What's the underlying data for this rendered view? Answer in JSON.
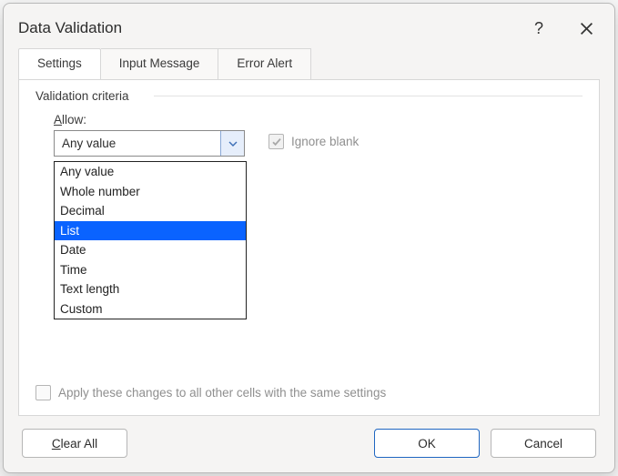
{
  "title": "Data Validation",
  "tabs": {
    "settings": "Settings",
    "input_message": "Input Message",
    "error_alert": "Error Alert"
  },
  "criteria": {
    "title": "Validation criteria",
    "allow_label_pre": "A",
    "allow_label_post": "llow:",
    "selected": "Any value",
    "options": {
      "any_value": "Any value",
      "whole_number": "Whole number",
      "decimal": "Decimal",
      "list": "List",
      "date": "Date",
      "time": "Time",
      "text_length": "Text length",
      "custom": "Custom"
    },
    "highlighted": "list"
  },
  "ignore_blank": {
    "label": "Ignore blank",
    "checked": true,
    "enabled": false
  },
  "apply_all": {
    "label": "Apply these changes to all other cells with the same settings",
    "checked": false,
    "enabled": false
  },
  "buttons": {
    "clear_all_pre": "C",
    "clear_all_post": "lear All",
    "ok": "OK",
    "cancel": "Cancel"
  }
}
